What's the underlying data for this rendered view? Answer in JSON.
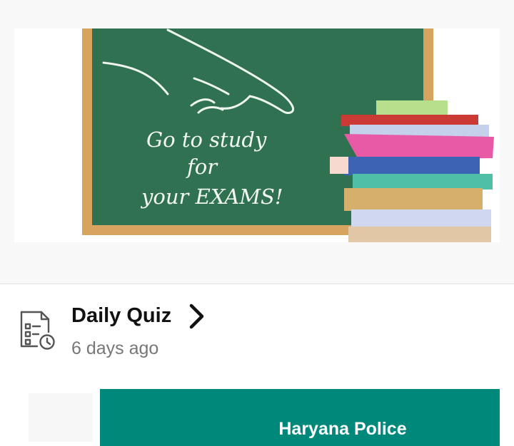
{
  "banner": {
    "chalk_text": [
      "Go to study",
      "for",
      "your EXAMS!"
    ],
    "icon": "chalkboard-with-books-illustration"
  },
  "quiz": {
    "title": "Daily Quiz",
    "time": "6 days ago",
    "icon": "timed-checklist-icon",
    "chevron_icon": "chevron-right-icon"
  },
  "card": {
    "title": "Haryana Police"
  },
  "colors": {
    "board": "#2f7150",
    "frame": "#d6a45e",
    "card": "#00897b"
  }
}
